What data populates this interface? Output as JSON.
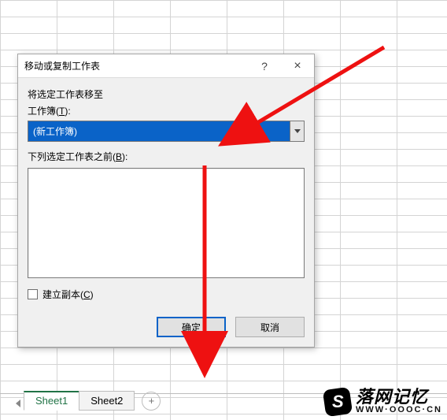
{
  "dialog": {
    "title": "移动或复制工作表",
    "help_label": "?",
    "close_label": "×",
    "move_to_label": "将选定工作表移至",
    "workbook_label_pre": "工作簿(",
    "workbook_accel": "T",
    "workbook_label_post": "):",
    "workbook_value": "(新工作簿)",
    "before_label_pre": "下列选定工作表之前(",
    "before_accel": "B",
    "before_label_post": "):",
    "copy_label_pre": "建立副本(",
    "copy_accel": "C",
    "copy_label_post": ")",
    "ok_label": "确定",
    "cancel_label": "取消"
  },
  "tabs": {
    "items": [
      "Sheet1",
      "Sheet2"
    ],
    "add_label": "+"
  },
  "watermark": {
    "logo_letter": "S",
    "brand": "落网记忆",
    "url": "WWW·OOOC·CN"
  }
}
